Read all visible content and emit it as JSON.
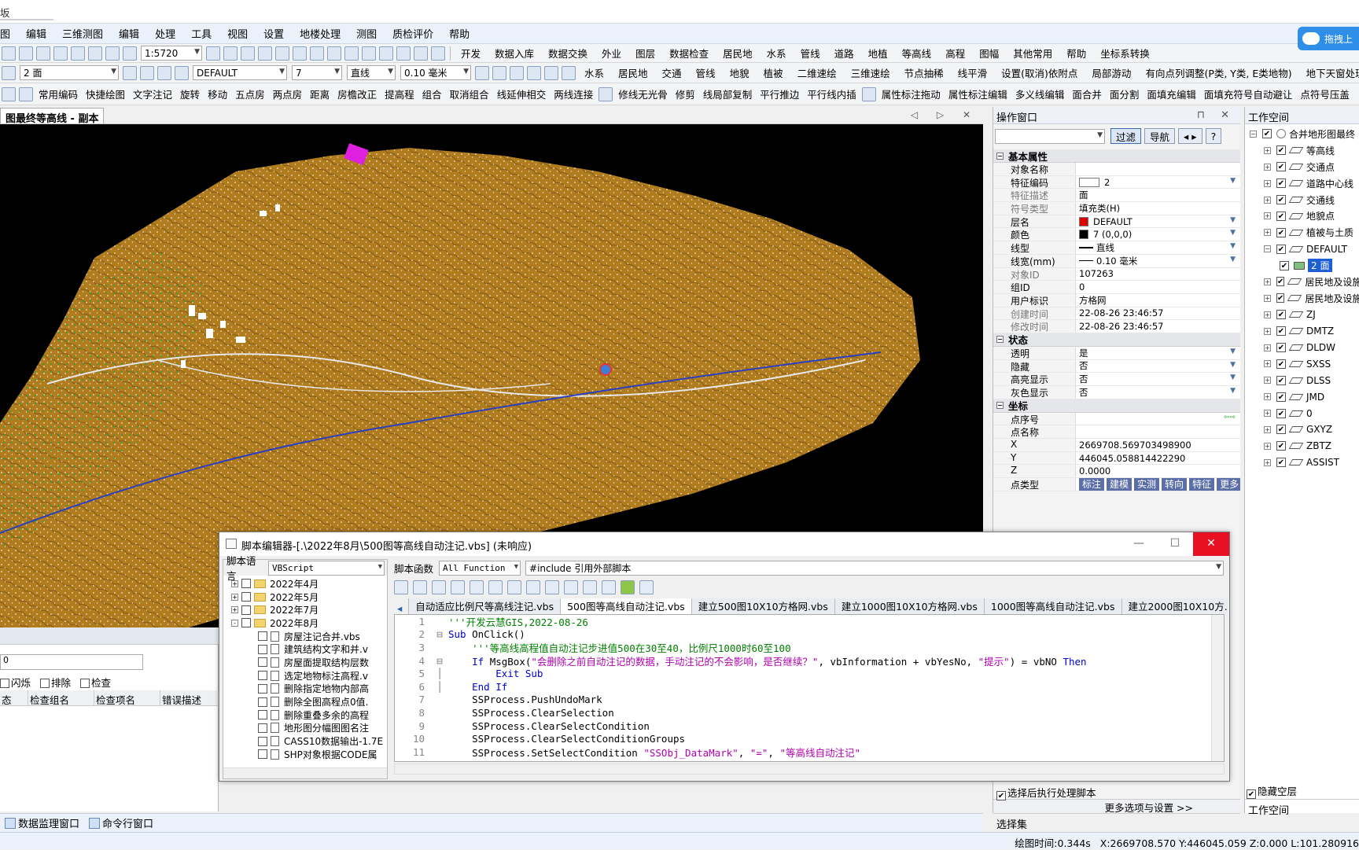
{
  "title_fragment": "坂",
  "menu": [
    "图",
    "编辑",
    "三维测图",
    "编辑",
    "处理",
    "工具",
    "视图",
    "设置",
    "地楼处理",
    "测图",
    "质检评价",
    "帮助"
  ],
  "toolbar1": {
    "scale": "1:5720",
    "right_items": [
      "开发",
      "数据入库",
      "数据交换",
      "外业",
      "图层",
      "数据检查",
      "居民地",
      "水系",
      "管线",
      "道路",
      "地植",
      "等高线",
      "高程",
      "图幅",
      "其他常用",
      "帮助",
      "坐标系转换"
    ]
  },
  "toolbar2": {
    "feature_combo": "2 面",
    "layer_combo": "DEFAULT",
    "color_combo": "7",
    "line_combo": "直线",
    "width_combo": "0.10 毫米",
    "items": [
      "水系",
      "居民地",
      "交通",
      "管线",
      "地貌",
      "植被",
      "二维速绘",
      "三维速绘",
      "节点抽稀",
      "线平滑",
      "设置(取消)依附点",
      "局部游动",
      "有向点列调整(P类, Y类, E类地物)",
      "地下天窗处理"
    ]
  },
  "toolbar3": {
    "items": [
      "常用编码",
      "快捷绘图",
      "文字注记",
      "旋转",
      "移动",
      "五点房",
      "两点房",
      "距离",
      "房檐改正",
      "提高程",
      "组合",
      "取消组合",
      "线延伸相交",
      "两线连接",
      "修线无光骨",
      "修剪",
      "线局部复制",
      "平行推边",
      "平行线内插",
      "属性标注拖动",
      "属性标注编辑",
      "多义线编辑",
      "面合并",
      "面分割",
      "面填充编辑",
      "面填充符号自动避让",
      "点符号压盖"
    ]
  },
  "canvas": {
    "tab_title": "图最终等高线 - 副本",
    "controls": "◁ ▷ ✕"
  },
  "left_panel": {
    "input_value": "0",
    "checks": [
      "闪烁",
      "排除",
      "检查"
    ],
    "columns": [
      "态",
      "检查组名",
      "检查项名",
      "错误描述"
    ]
  },
  "bottom_tabs": [
    "数据监理窗口",
    "命令行窗口"
  ],
  "status": {
    "draw_time": "绘图时间:0.344s",
    "coords": "X:2669708.570 Y:446045.059 Z:0.000 L:101.280916"
  },
  "op_panel": {
    "title": "操作窗口",
    "filter_btn": "过滤",
    "nav_btn": "导航",
    "sections": {
      "basic": "基本属性",
      "state": "状态",
      "coord": "坐标"
    },
    "basic_rows": [
      {
        "k": "对象名称",
        "v": ""
      },
      {
        "k": "特征编码",
        "v": "2"
      },
      {
        "k": "特征描述",
        "v": "面"
      },
      {
        "k": "符号类型",
        "v": "填充类(H)"
      },
      {
        "k": "层名",
        "v": "DEFAULT"
      },
      {
        "k": "颜色",
        "v": "7 (0,0,0)"
      },
      {
        "k": "线型",
        "v": "直线"
      },
      {
        "k": "线宽(mm)",
        "v": "0.10 毫米"
      },
      {
        "k": "对象ID",
        "v": "107263"
      },
      {
        "k": "组ID",
        "v": "0"
      },
      {
        "k": "用户标识",
        "v": "方格网"
      },
      {
        "k": "创建时间",
        "v": "22-08-26 23:46:57"
      },
      {
        "k": "修改时间",
        "v": "22-08-26 23:46:57"
      }
    ],
    "state_rows": [
      {
        "k": "透明",
        "v": "是"
      },
      {
        "k": "隐藏",
        "v": "否"
      },
      {
        "k": "高亮显示",
        "v": "否"
      },
      {
        "k": "灰色显示",
        "v": "否"
      }
    ],
    "coord_rows": [
      {
        "k": "点序号",
        "v": ""
      },
      {
        "k": "点名称",
        "v": ""
      },
      {
        "k": "X",
        "v": "2669708.569703498900"
      },
      {
        "k": "Y",
        "v": "446045.058814422290"
      },
      {
        "k": "Z",
        "v": "0.0000"
      }
    ],
    "point_type_label": "点类型",
    "point_type_tags": [
      "标注",
      "建模",
      "实测",
      "转向",
      "特征",
      "更多"
    ],
    "footer_check": "选择后执行处理脚本",
    "footer_more": "更多选项与设置 >>",
    "footer_tab": "选择集"
  },
  "workspace": {
    "title": "工作空间",
    "root": "合并地形图最终",
    "layers": [
      "等高线",
      "交通点",
      "道路中心线",
      "交通线",
      "地貌点",
      "植被与土质",
      "DEFAULT",
      "居民地及设施",
      "居民地及设施",
      "ZJ",
      "DMTZ",
      "DLDW",
      "SXSS",
      "DLSS",
      "JMD",
      "0",
      "GXYZ",
      "ZBTZ",
      "ASSIST"
    ],
    "sub_item": "2 面",
    "hide_empty": "隐藏空层",
    "footer_tab": "工作空间"
  },
  "cloud_btn": "拖拽上",
  "editor": {
    "title": "脚本编辑器-[.\\2022年8月\\500图等高线自动注记.vbs] (未响应)",
    "lang_label": "脚本语言",
    "lang_value": "VBScript",
    "func_label": "脚本函数",
    "func_value": "All Function",
    "include_value": "#include 引用外部脚本",
    "tree": [
      {
        "type": "folder",
        "label": "2022年4月",
        "exp": "+"
      },
      {
        "type": "folder",
        "label": "2022年5月",
        "exp": "+"
      },
      {
        "type": "folder",
        "label": "2022年7月",
        "exp": "+"
      },
      {
        "type": "folder",
        "label": "2022年8月",
        "exp": "-"
      },
      {
        "type": "file",
        "label": "房屋注记合并.vbs"
      },
      {
        "type": "file",
        "label": "建筑结构文字和并.v"
      },
      {
        "type": "file",
        "label": "房屋面提取结构层数"
      },
      {
        "type": "file",
        "label": "选定地物标注高程.v"
      },
      {
        "type": "file",
        "label": "删除指定地物内部高"
      },
      {
        "type": "file",
        "label": "删除全图高程点0值."
      },
      {
        "type": "file",
        "label": "删除重叠多余的高程"
      },
      {
        "type": "file",
        "label": "地形图分幅图图名注"
      },
      {
        "type": "file",
        "label": "CASS10数据输出-1.7E"
      },
      {
        "type": "file",
        "label": "SHP对象根据CODE属"
      }
    ],
    "tabs": [
      "自动适应比例尺等高线注记.vbs",
      "500图等高线自动注记.vbs",
      "建立500图10X10方格网.vbs",
      "建立1000图10X10方格网.vbs",
      "1000图等高线自动注记.vbs",
      "建立2000图10X10方..."
    ],
    "active_tab": 1,
    "code": [
      "'''开发云慧GIS,2022-08-26",
      "Sub OnClick()",
      "    '''等高线高程值自动注记步进值500在30至40，比例尺1000时60至100",
      "    If MsgBox(\"会删除之前自动注记的数据，手动注记的不会影响，是否继续？\", vbInformation + vbYesNo, \"提示\") = vbNO Then",
      "        Exit Sub",
      "    End If",
      "    SSProcess.PushUndoMark",
      "    SSProcess.ClearSelection",
      "    SSProcess.ClearSelectCondition",
      "    SSProcess.ClearSelectConditionGroups",
      "    SSProcess.SetSelectCondition \"SSObj_DataMark\", \"=\", \"等高线自动注记\""
    ]
  }
}
